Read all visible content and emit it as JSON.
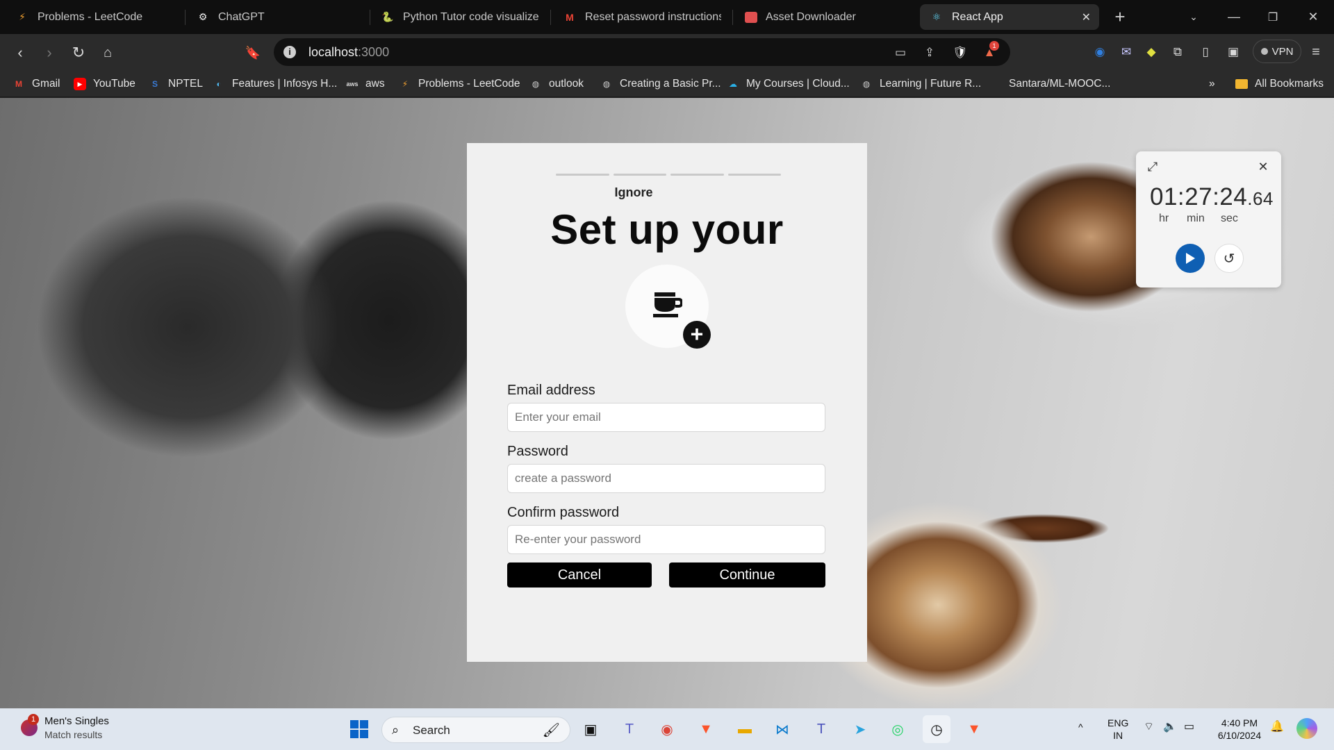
{
  "browser": {
    "tabs": [
      {
        "title": "Problems - LeetCode",
        "icon": "leetcode-icon"
      },
      {
        "title": "ChatGPT",
        "icon": "chatgpt-icon"
      },
      {
        "title": "Python Tutor code visualizer: Vi",
        "icon": "python-icon"
      },
      {
        "title": "Reset password instructions - k",
        "icon": "gmail-icon"
      },
      {
        "title": "Asset Downloader",
        "icon": "asset-icon"
      },
      {
        "title": "React App",
        "icon": "react-icon",
        "active": true
      }
    ],
    "url_host": "localhost",
    "url_port": ":3000",
    "vpn_label": "VPN",
    "brave_badge": "1",
    "bookmarks": [
      {
        "label": "Gmail",
        "icon": "gmail-icon"
      },
      {
        "label": "YouTube",
        "icon": "youtube-icon"
      },
      {
        "label": "NPTEL",
        "icon": "nptel-icon"
      },
      {
        "label": "Features | Infosys H...",
        "icon": "infosys-icon"
      },
      {
        "label": "aws",
        "icon": "aws-icon"
      },
      {
        "label": "Problems - LeetCode",
        "icon": "leetcode-icon"
      },
      {
        "label": "outlook",
        "icon": "globe-icon"
      },
      {
        "label": "Creating a Basic Pr...",
        "icon": "globe-icon"
      },
      {
        "label": "My Courses | Cloud...",
        "icon": "cloud-icon"
      },
      {
        "label": "Learning | Future R...",
        "icon": "globe-icon"
      },
      {
        "label": "Santara/ML-MOOC...",
        "icon": "github-icon"
      }
    ],
    "all_bookmarks": "All Bookmarks",
    "overflow": "»"
  },
  "signup": {
    "ignore": "Ignore",
    "title": "Set up your",
    "email_label": "Email address",
    "email_placeholder": "Enter your email",
    "password_label": "Password",
    "password_placeholder": "create a password",
    "confirm_label": "Confirm password",
    "confirm_placeholder": "Re-enter your password",
    "cancel": "Cancel",
    "continue": "Continue",
    "progress_steps": 4
  },
  "stopwatch": {
    "time_main": "01:27:24",
    "time_ms": ".64",
    "units": [
      "hr",
      "min",
      "sec"
    ]
  },
  "taskbar": {
    "news_title": "Men's Singles",
    "news_sub": "Match results",
    "news_badge": "1",
    "search": "Search",
    "lang1": "ENG",
    "lang2": "IN",
    "time": "4:40 PM",
    "date": "6/10/2024"
  },
  "colors": {
    "accent_blue": "#0f5fb3",
    "button_black": "#000000",
    "card_bg": "#f0f0f0"
  }
}
